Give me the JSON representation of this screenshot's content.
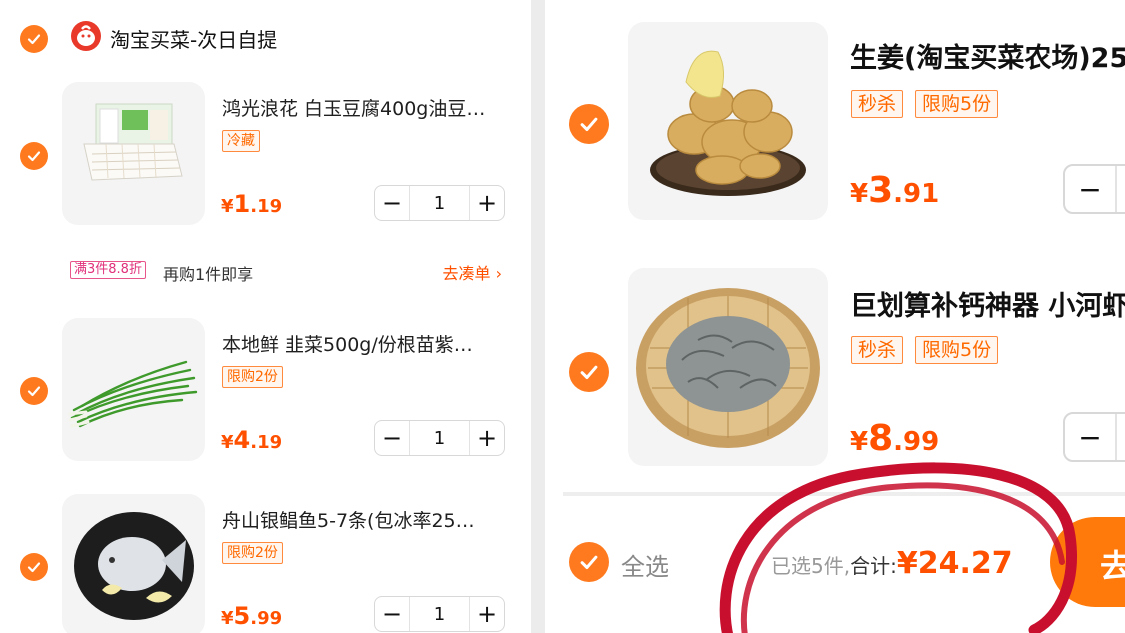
{
  "store": {
    "name": "淘宝买菜-次日自提"
  },
  "left_items": [
    {
      "title": "鸿光浪花 白玉豆腐400g油豆…",
      "tags": [
        "冷藏"
      ],
      "price_int": "1",
      "price_dec": ".19",
      "qty": "1"
    },
    {
      "title": "本地鲜 韭菜500g/份根苗紫…",
      "tags": [
        "限购2份"
      ],
      "price_int": "4",
      "price_dec": ".19",
      "qty": "1"
    },
    {
      "title": "舟山银鲳鱼5-7条(包冰率25…",
      "tags": [
        "限购2份"
      ],
      "price_int": "5",
      "price_dec": ".99",
      "qty": "1"
    }
  ],
  "promo": {
    "tag": "满3件8.8折",
    "text": "再购1件即享",
    "link": "去凑单 ›"
  },
  "right_items": [
    {
      "title": "生姜(淘宝买菜农场)25",
      "tags": [
        "秒杀",
        "限购5份"
      ],
      "price_int": "3",
      "price_dec": ".91"
    },
    {
      "title": "巨划算补钙神器 小河虾",
      "tags": [
        "秒杀",
        "限购5份"
      ],
      "price_int": "8",
      "price_dec": ".99"
    }
  ],
  "currency": "¥",
  "stepper": {
    "minus": "−",
    "plus": "+"
  },
  "footer": {
    "select_all": "全选",
    "selected_count": "已选5件,",
    "total_label": "合计:",
    "total_value": "¥24.27",
    "checkout_label": "去"
  },
  "colors": {
    "accent": "#ff7a1f",
    "price": "#ff5000",
    "annotation": "#c8102e"
  }
}
